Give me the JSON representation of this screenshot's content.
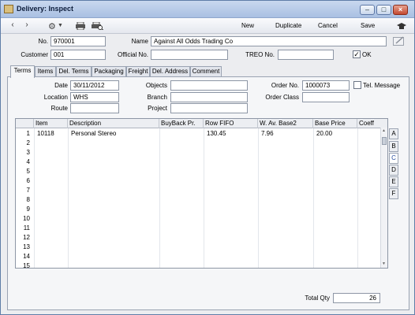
{
  "window": {
    "title": "Delivery: Inspect"
  },
  "toolbar": {
    "back": "‹",
    "forward": "›",
    "new": "New",
    "duplicate": "Duplicate",
    "cancel": "Cancel",
    "save": "Save"
  },
  "header": {
    "no_label": "No.",
    "no_value": "970001",
    "name_label": "Name",
    "name_value": "Against All Odds Trading Co",
    "customer_label": "Customer",
    "customer_value": "001",
    "official_label": "Official No.",
    "official_value": "",
    "treo_label": "TREO No.",
    "treo_value": "",
    "ok_label": "OK",
    "ok_checked": "✓"
  },
  "tabs": [
    "Terms",
    "Items",
    "Del. Terms",
    "Packaging",
    "Freight",
    "Del. Address",
    "Comment"
  ],
  "terms": {
    "date_label": "Date",
    "date_value": "30/11/2012",
    "location_label": "Location",
    "location_value": "WHS",
    "route_label": "Route",
    "route_value": "",
    "objects_label": "Objects",
    "objects_value": "",
    "branch_label": "Branch",
    "branch_value": "",
    "project_label": "Project",
    "project_value": "",
    "order_no_label": "Order No.",
    "order_no_value": "1000073",
    "order_class_label": "Order Class",
    "order_class_value": "",
    "tel_message_label": "Tel. Message"
  },
  "grid": {
    "columns": [
      "Item",
      "Description",
      "BuyBack Pr.",
      "Row FIFO",
      "W. Av. Base2",
      "Base Price",
      "Coeff"
    ],
    "row_numbers": [
      "1",
      "2",
      "3",
      "4",
      "5",
      "6",
      "7",
      "8",
      "9",
      "10",
      "11",
      "12",
      "13",
      "14",
      "15"
    ],
    "rows": [
      {
        "item": "10118",
        "description": "Personal Stereo",
        "buyback": "",
        "row_fifo": "130.45",
        "wav_base2": "7.96",
        "base_price": "20.00",
        "coeff": ""
      }
    ],
    "side_tabs": [
      "A",
      "B",
      "C",
      "D",
      "E",
      "F"
    ]
  },
  "footer": {
    "total_qty_label": "Total Qty",
    "total_qty_value": "26"
  }
}
